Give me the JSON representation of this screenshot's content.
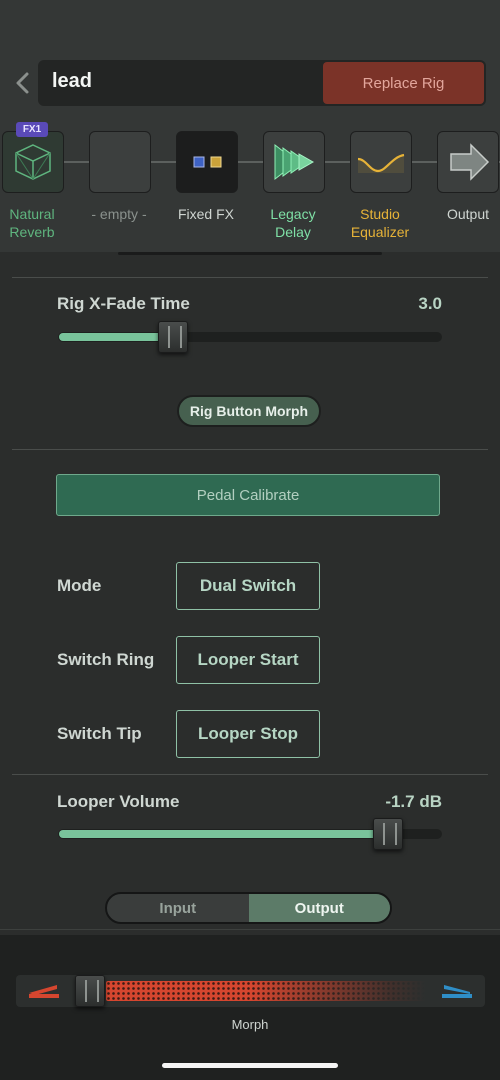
{
  "header": {
    "rig_name": "lead",
    "replace_label": "Replace Rig"
  },
  "chain": {
    "badge": "FX1",
    "slots": [
      {
        "label": "Natural\nReverb",
        "icon": "reverb-cube-icon",
        "color": "#5fb57f"
      },
      {
        "label": "- empty -",
        "icon": "none",
        "color": "#8a918d"
      },
      {
        "label": "Fixed FX",
        "icon": "fixed-fx-icon",
        "color": "#cfd5d1"
      },
      {
        "label": "Legacy\nDelay",
        "icon": "delay-icon",
        "color": "#7fe0a6"
      },
      {
        "label": "Studio\nEqualizer",
        "icon": "equalizer-icon",
        "color": "#e7b338"
      },
      {
        "label": "Output",
        "icon": "output-arrow-icon",
        "color": "#cfd5d1"
      }
    ]
  },
  "xfade": {
    "label": "Rig X-Fade Time",
    "value": "3.0",
    "level": 0.3
  },
  "morph_button_label": "Rig Button Morph",
  "calibrate_label": "Pedal Calibrate",
  "switches": {
    "mode": {
      "label": "Mode",
      "value": "Dual Switch"
    },
    "ring": {
      "label": "Switch Ring",
      "value": "Looper Start"
    },
    "tip": {
      "label": "Switch Tip",
      "value": "Looper Stop"
    }
  },
  "looper": {
    "label": "Looper Volume",
    "value": "-1.7 dB",
    "level": 0.86
  },
  "segment": {
    "options": [
      "Input",
      "Output"
    ],
    "selected": "Output"
  },
  "morph": {
    "label": "Morph",
    "level": 0.05
  }
}
